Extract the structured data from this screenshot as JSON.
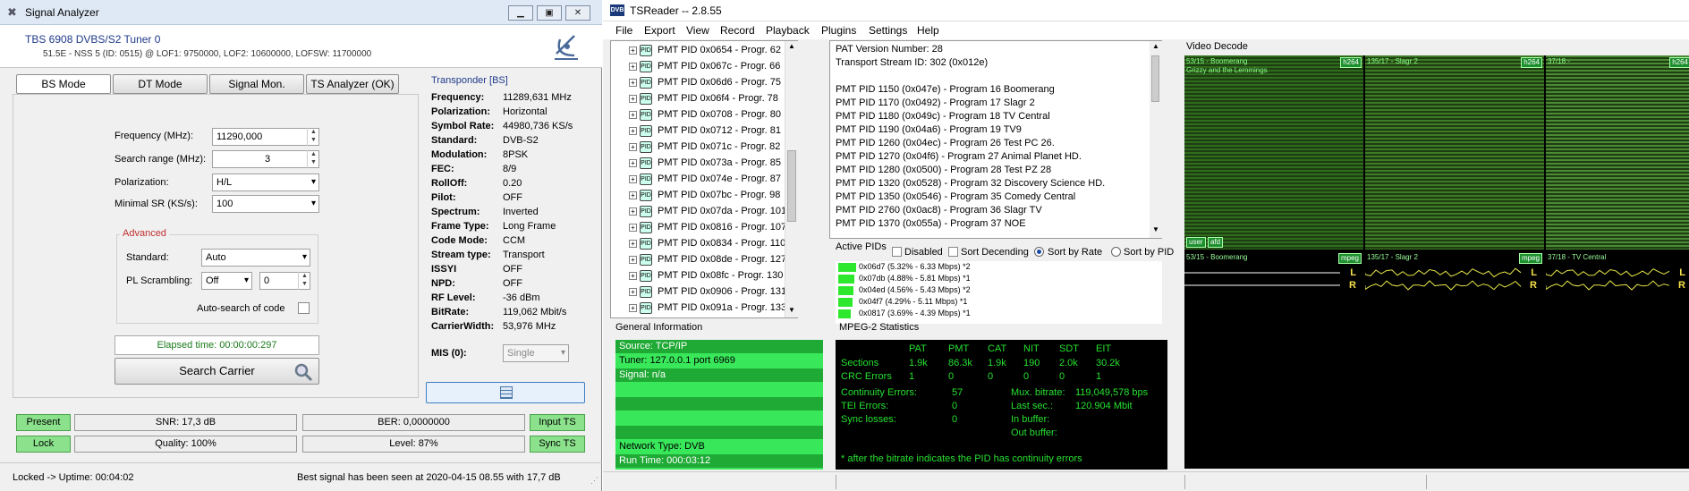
{
  "analyzer": {
    "window_title": "Signal Analyzer",
    "tuner_name": "TBS 6908 DVBS/S2 Tuner 0",
    "tuner_info": "51.5E - NSS 5 (ID: 0515) @ LOF1: 9750000, LOF2: 10600000, LOFSW: 11700000",
    "tabs": [
      "BS Mode",
      "DT Mode",
      "Signal Mon.",
      "TS Analyzer (OK)"
    ],
    "form": {
      "frequency_label": "Frequency (MHz):",
      "frequency_value": "11290,000",
      "search_range_label": "Search range (MHz):",
      "search_range_value": "3",
      "polarization_label": "Polarization:",
      "polarization_value": "H/L",
      "min_sr_label": "Minimal SR (KS/s):",
      "min_sr_value": "100"
    },
    "advanced": {
      "title": "Advanced",
      "standard_label": "Standard:",
      "standard_value": "Auto",
      "pl_label": "PL Scrambling:",
      "pl_value": "Off",
      "pl_num": "0",
      "auto_search_label": "Auto-search of code"
    },
    "elapsed": "Elapsed time: 00:00:00:297",
    "search_button": "Search Carrier",
    "transponder": {
      "title": "Transponder [BS]",
      "rows": [
        {
          "k": "Frequency:",
          "v": "11289,631 MHz"
        },
        {
          "k": "Polarization:",
          "v": "Horizontal"
        },
        {
          "k": "Symbol Rate:",
          "v": "44980,736 KS/s"
        },
        {
          "k": "Standard:",
          "v": "DVB-S2"
        },
        {
          "k": "Modulation:",
          "v": "8PSK"
        },
        {
          "k": "FEC:",
          "v": "8/9"
        },
        {
          "k": "RollOff:",
          "v": "0.20"
        },
        {
          "k": "Pilot:",
          "v": "OFF"
        },
        {
          "k": "Spectrum:",
          "v": "Inverted"
        },
        {
          "k": "Frame Type:",
          "v": "Long Frame"
        },
        {
          "k": "Code Mode:",
          "v": "CCM"
        },
        {
          "k": "Stream type:",
          "v": "Transport"
        },
        {
          "k": "ISSYI",
          "v": "OFF"
        },
        {
          "k": "NPD:",
          "v": "OFF"
        },
        {
          "k": "RF Level:",
          "v": "-36 dBm"
        },
        {
          "k": "BitRate:",
          "v": "119,062 Mbit/s"
        },
        {
          "k": "CarrierWidth:",
          "v": "53,976 MHz"
        }
      ],
      "mis_label": "MIS (0):",
      "mis_value": "Single"
    },
    "status": {
      "present": "Present",
      "lock": "Lock",
      "input_ts": "Input TS",
      "sync_ts": "Sync TS",
      "snr": "SNR: 17,3 dB",
      "snr_level": 0.55,
      "ber": "BER: 0,0000000",
      "ber_level": 1.0,
      "quality": "Quality: 100%",
      "quality_level": 1.0,
      "level": "Level: 87%",
      "level_level": 0.87
    },
    "footer_left": "Locked -> Uptime: 00:04:02",
    "footer_right": "Best signal has been seen at 2020-04-15 08.55 with 17,7 dB"
  },
  "tsreader": {
    "window_title": "TSReader -- 2.8.55",
    "app_badge": "DVB",
    "menu": [
      "File",
      "Export",
      "View",
      "Record",
      "Playback",
      "Plugins",
      "Settings",
      "Help"
    ],
    "tree_items": [
      "PMT PID 0x0654 - Progr. 62",
      "PMT PID 0x067c - Progr. 66",
      "PMT PID 0x06d6 - Progr. 75",
      "PMT PID 0x06f4 - Progr. 78",
      "PMT PID 0x0708 - Progr. 80",
      "PMT PID 0x0712 - Progr. 81",
      "PMT PID 0x071c - Progr. 82",
      "PMT PID 0x073a - Progr. 85",
      "PMT PID 0x074e - Progr. 87",
      "PMT PID 0x07bc - Progr. 98",
      "PMT PID 0x07da - Progr. 101",
      "PMT PID 0x0816 - Progr. 107",
      "PMT PID 0x0834 - Progr. 110",
      "PMT PID 0x08de - Progr. 127",
      "PMT PID 0x08fc - Progr. 130",
      "PMT PID 0x0906 - Progr. 131",
      "PMT PID 0x091a - Progr. 133"
    ],
    "pat_lines": [
      "PAT Version Number: 28",
      "Transport Stream ID: 302 (0x012e)",
      "",
      "PMT PID 1150 (0x047e) - Program 16 Boomerang",
      "PMT PID 1170 (0x0492) - Program 17 Slagr 2",
      "PMT PID 1180 (0x049c) - Program 18 TV Central",
      "PMT PID 1190 (0x04a6) - Program 19 TV9",
      "PMT PID 1260 (0x04ec) - Program 26 Test PC 26.",
      "PMT PID 1270 (0x04f6) - Program 27 Animal Planet HD.",
      "PMT PID 1280 (0x0500) - Program 28 Test PZ 28",
      "PMT PID 1320 (0x0528) - Program 32 Discovery Science HD.",
      "PMT PID 1350 (0x0546) - Program 35 Comedy Central",
      "PMT PID 2760 (0x0ac8) - Program 36 Slagr TV",
      "PMT PID 1370 (0x055a) - Program 37 NOE"
    ],
    "active_pids": {
      "title": "Active PIDs",
      "disabled": "Disabled",
      "sort_desc": "Sort Decending",
      "sort_rate": "Sort by Rate",
      "sort_pid": "Sort by PID",
      "items": [
        {
          "text": "0x06d7 (5.32% - 6.33 Mbps) *2",
          "fill": 1.0
        },
        {
          "text": "0x07db (4.88% - 5.81 Mbps) *1",
          "fill": 0.92
        },
        {
          "text": "0x04ed (4.56% - 5.43 Mbps) *2",
          "fill": 0.86
        },
        {
          "text": "0x04f7 (4.29% - 5.11 Mbps) *1",
          "fill": 0.81
        },
        {
          "text": "0x0817 (3.69% - 4.39 Mbps) *1",
          "fill": 0.69
        }
      ]
    },
    "general": {
      "title": "General Information",
      "rows": [
        "Source: TCP/IP",
        "Tuner: 127.0.0.1 port 6969",
        "Signal: n/a",
        "",
        "",
        "",
        "",
        "Network Type: DVB",
        "Run Time: 000:03:12"
      ]
    },
    "mpeg": {
      "title": "MPEG-2 Statistics",
      "headers": [
        "PAT",
        "PMT",
        "CAT",
        "NIT",
        "SDT",
        "EIT"
      ],
      "sections_label": "Sections",
      "sections": [
        "1.9k",
        "86.3k",
        "1.9k",
        "190",
        "2.0k",
        "30.2k"
      ],
      "crc_label": "CRC Errors",
      "crc": [
        "1",
        "0",
        "0",
        "0",
        "0",
        "1"
      ],
      "continuity_label": "Continuity Errors:",
      "continuity": "57",
      "tei_label": "TEI Errors:",
      "tei": "0",
      "sync_label": "Sync losses:",
      "sync": "0",
      "mux_label": "Mux. bitrate:",
      "mux": "119,049,578 bps",
      "last_label": "Last sec.:",
      "last": "120.904 Mbit",
      "inbuf_label": "In buffer:",
      "outbuf_label": "Out buffer:",
      "footnote": "* after the bitrate indicates the PID has continuity errors"
    },
    "video": {
      "title": "Video Decode",
      "tiles": [
        {
          "label": "53/15 - Boomerang",
          "codec": "h264",
          "sub": "Grizzy and the Lemmings",
          "color": "#2f6d1c"
        },
        {
          "label": "135/17 - Slagr 2",
          "codec": "h264",
          "sub": "",
          "color": "#3f7a24"
        },
        {
          "label": "37/18 -",
          "codec": "h264",
          "sub": "",
          "color": "#4c8a33"
        }
      ],
      "tile_tags": [
        "user",
        "afd"
      ],
      "audio": [
        {
          "label": "53/15 - Boomerang",
          "codec": "mpeg"
        },
        {
          "label": "135/17 - Slagr 2",
          "codec": "mpeg"
        },
        {
          "label": "37/18 - TV Central",
          "codec": ""
        }
      ],
      "audio_channels": [
        "L",
        "R"
      ]
    }
  }
}
